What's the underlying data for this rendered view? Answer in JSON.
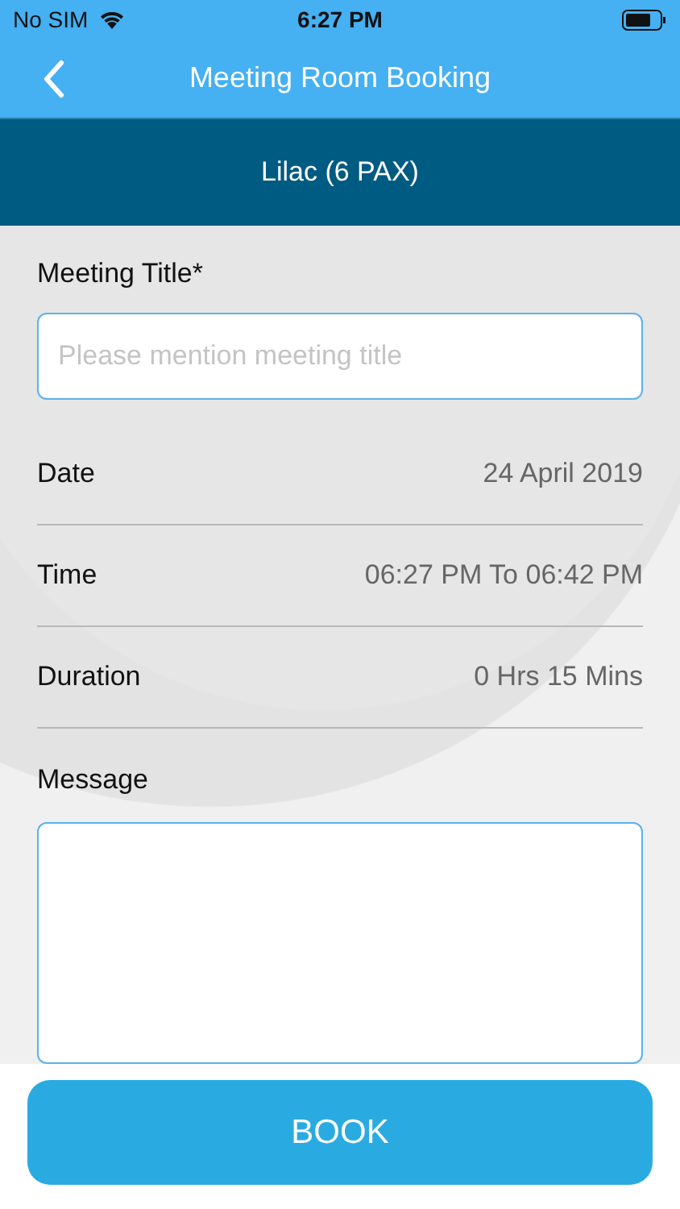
{
  "status_bar": {
    "carrier": "No SIM",
    "time": "6:27 PM"
  },
  "nav": {
    "title": "Meeting Room Booking"
  },
  "room": {
    "name": "Lilac (6 PAX)"
  },
  "title_field": {
    "label": "Meeting Title*",
    "placeholder": "Please mention meeting title"
  },
  "details": [
    {
      "label": "Date",
      "value": "24 April 2019"
    },
    {
      "label": "Time",
      "value": "06:27 PM To 06:42 PM"
    },
    {
      "label": "Duration",
      "value": "0 Hrs 15 Mins"
    }
  ],
  "message_field": {
    "label": "Message"
  },
  "book_button": {
    "label": "BOOK"
  }
}
